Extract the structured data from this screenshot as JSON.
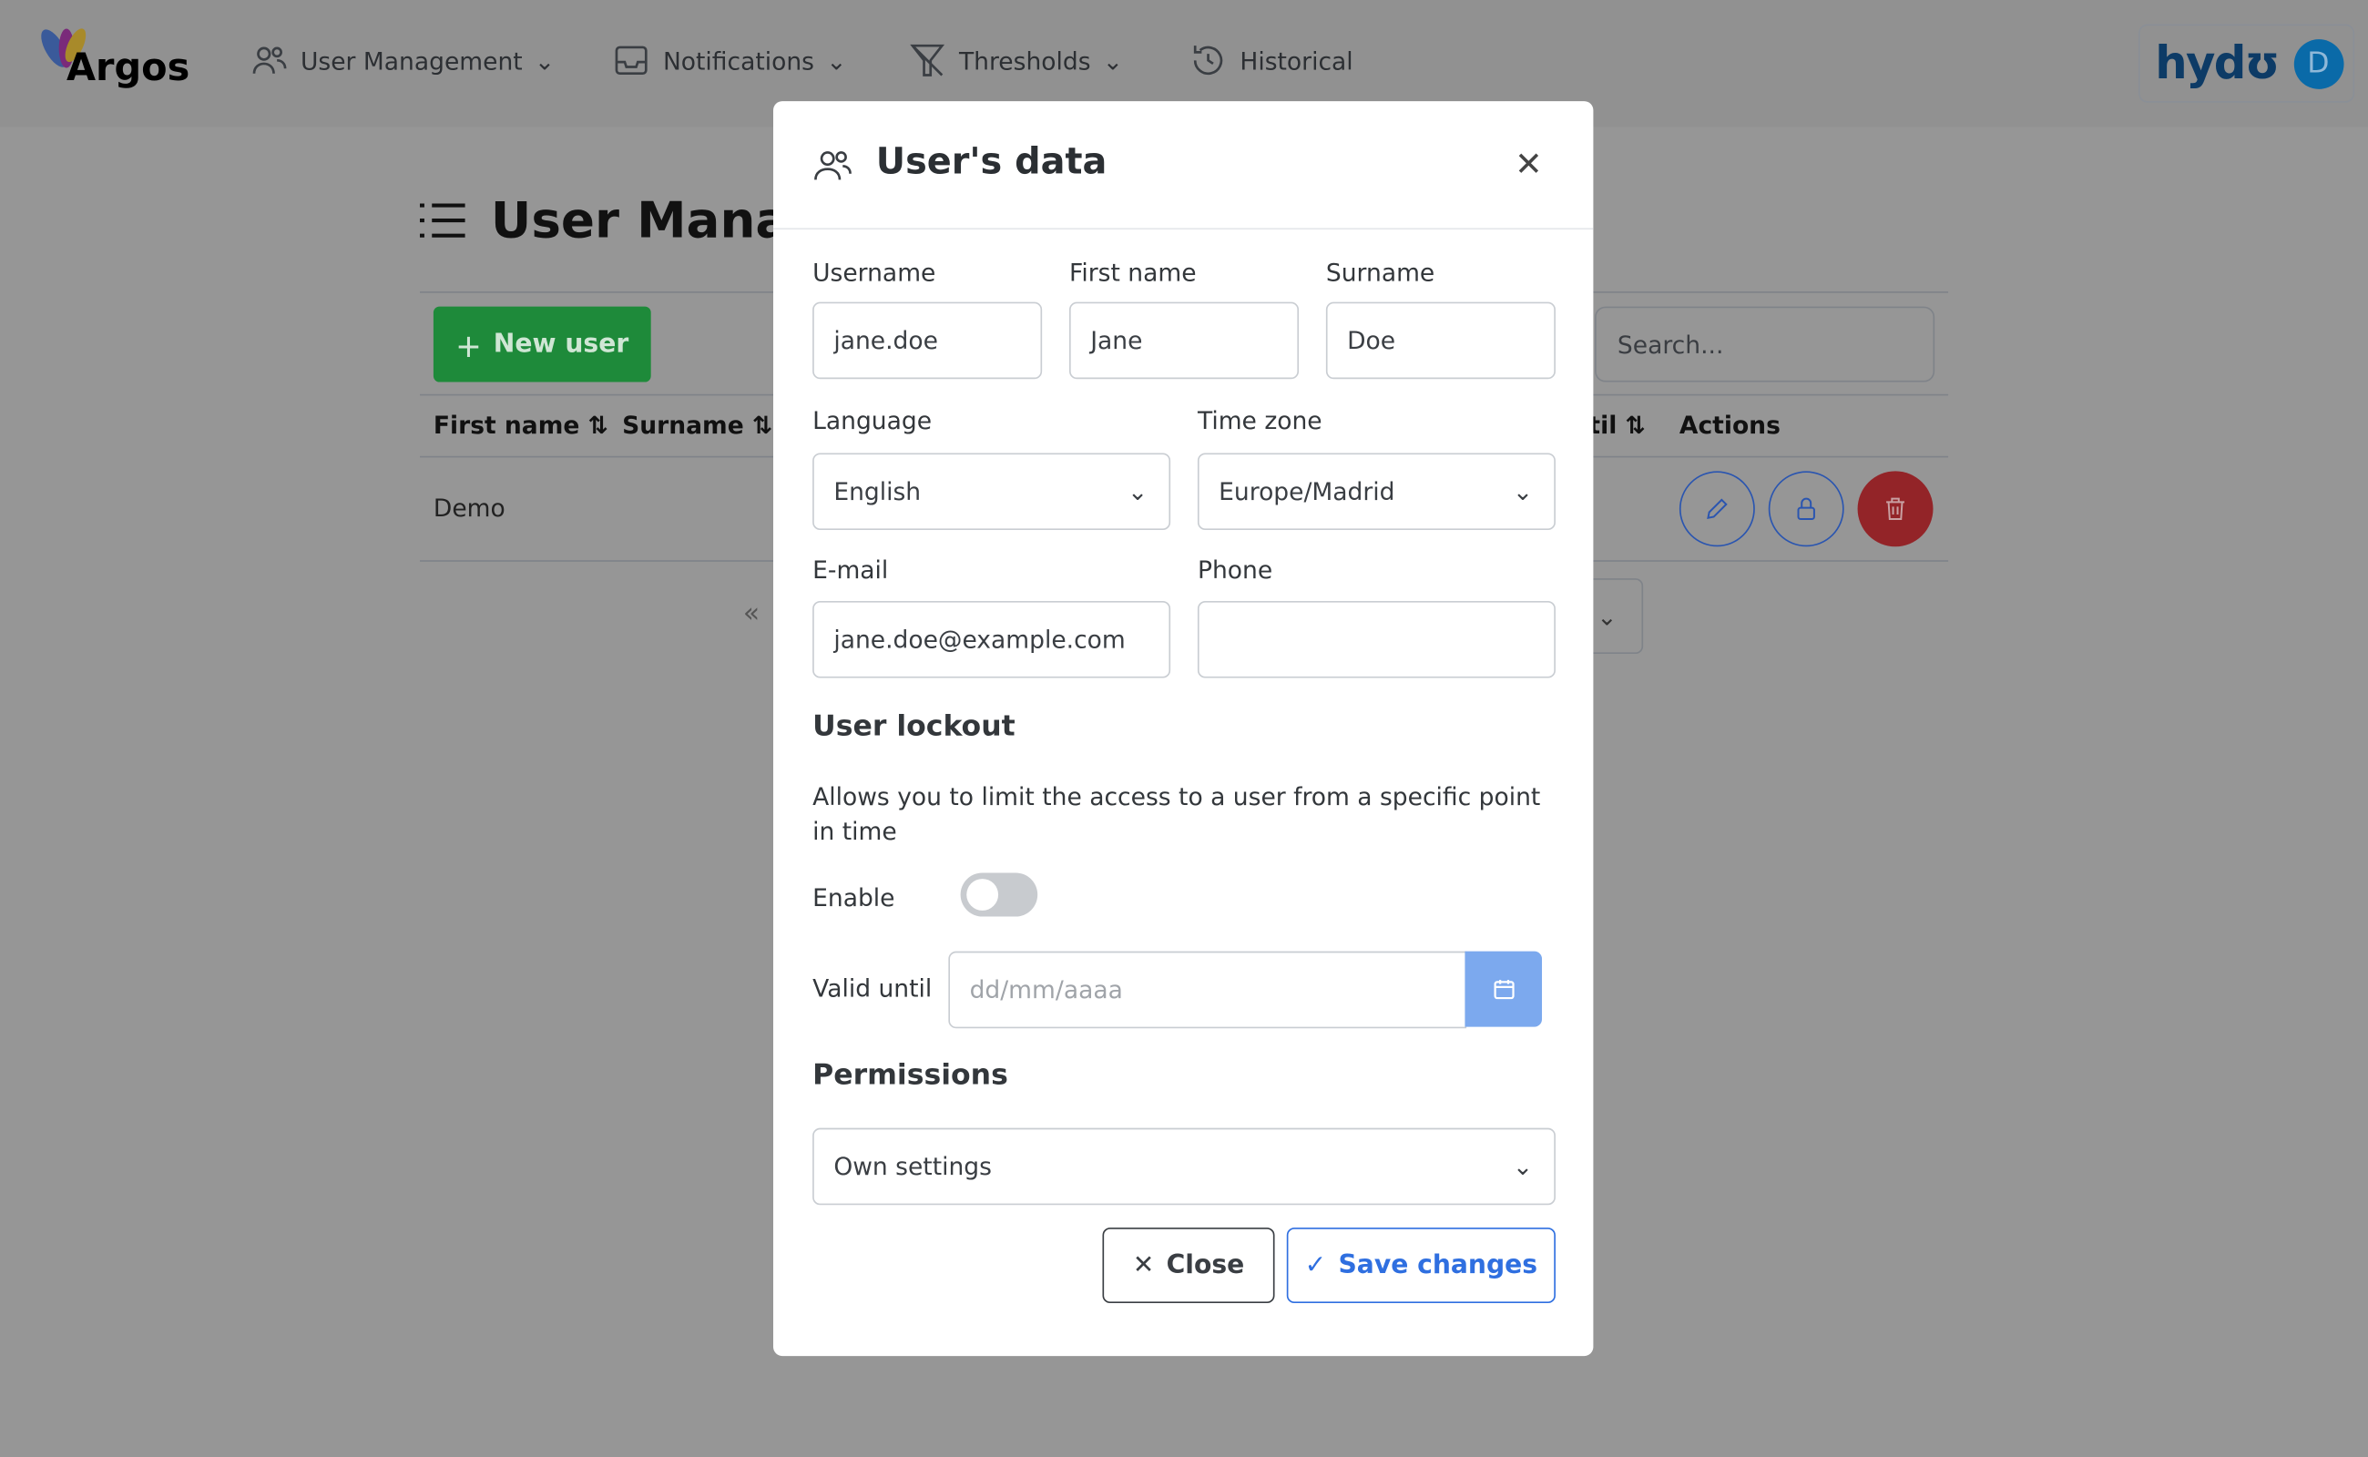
{
  "nav": {
    "logo": "Argos",
    "items": [
      {
        "label": "User Management",
        "icon": "users-icon"
      },
      {
        "label": "Notifications",
        "icon": "inbox-icon"
      },
      {
        "label": "Thresholds",
        "icon": "filter-icon"
      },
      {
        "label": "Historical",
        "icon": "history-icon"
      }
    ],
    "brand": "hydʊ",
    "avatar": "D"
  },
  "page": {
    "title": "User Manag",
    "new_user": "New user",
    "search_placeholder": "Search...",
    "columns": [
      "First name",
      "Surname",
      "til",
      "Actions"
    ],
    "rows": [
      {
        "first_name": "Demo"
      }
    ],
    "pagination_prev": "«"
  },
  "modal": {
    "title": "User's data",
    "username_label": "Username",
    "username": "jane.doe",
    "first_name_label": "First name",
    "first_name": "Jane",
    "surname_label": "Surname",
    "surname": "Doe",
    "language_label": "Language",
    "language": "English",
    "timezone_label": "Time zone",
    "timezone": "Europe/Madrid",
    "email_label": "E-mail",
    "email": "jane.doe@example.com",
    "phone_label": "Phone",
    "phone": "",
    "lockout_title": "User lockout",
    "lockout_desc": "Allows you to limit the access to a user from a specific point in time",
    "enable_label": "Enable",
    "enabled": false,
    "valid_until_label": "Valid until",
    "valid_until_placeholder": "dd/mm/aaaa",
    "permissions_title": "Permissions",
    "permissions": "Own settings",
    "close": "Close",
    "save": "Save changes"
  },
  "colors": {
    "primary": "#2f6fe0",
    "success": "#1e8a3a",
    "danger": "#932428",
    "overlay": "#969696"
  }
}
